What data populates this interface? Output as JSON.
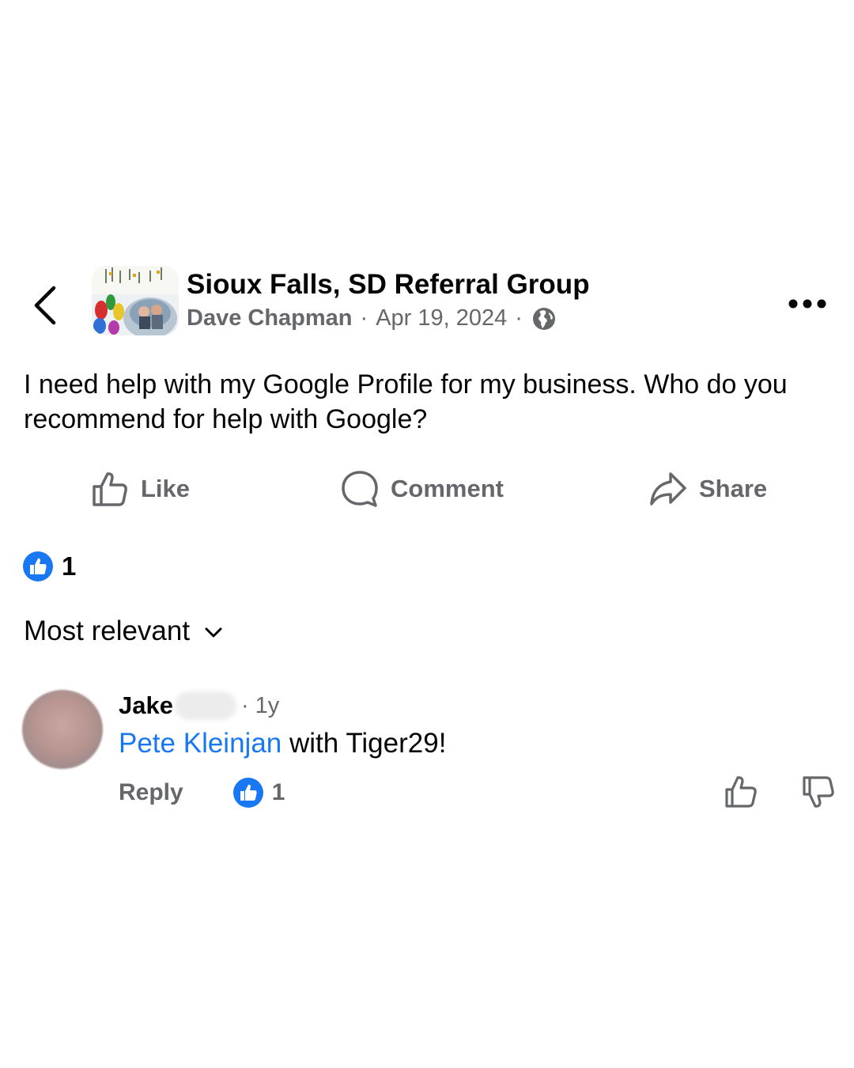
{
  "post": {
    "group_name": "Sioux Falls, SD Referral Group",
    "author": "Dave Chapman",
    "date": "Apr 19, 2024",
    "separator": "·",
    "text": "I need help with my Google Profile for my business.  Who do you recommend for help with Google?",
    "privacy_icon": "globe-icon",
    "reaction_count": "1"
  },
  "actions": {
    "like": "Like",
    "comment": "Comment",
    "share": "Share"
  },
  "comments_sort": {
    "label": "Most relevant"
  },
  "comment": {
    "author_first": "Jake",
    "time": "· 1y",
    "mention": "Pete Kleinjan",
    "text": " with Tiger29!",
    "reply_label": "Reply",
    "like_count": "1"
  },
  "colors": {
    "accent_blue": "#1877f2",
    "secondary_text": "#65676b",
    "primary_text": "#050505"
  }
}
